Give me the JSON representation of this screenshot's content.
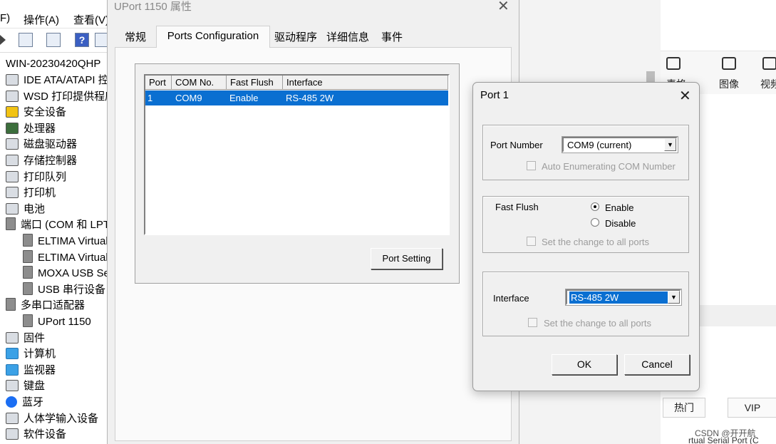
{
  "device_manager": {
    "menu": [
      "F)",
      "操作(A)",
      "查看(V)"
    ],
    "computer_name": "WIN-20230420QHP",
    "tree": [
      {
        "label": "IDE ATA/ATAPI 控",
        "icon": "ide-controller-icon"
      },
      {
        "label": "WSD 打印提供程序",
        "icon": "printer-provider-icon"
      },
      {
        "label": "安全设备",
        "icon": "security-device-icon"
      },
      {
        "label": "处理器",
        "icon": "processor-icon"
      },
      {
        "label": "磁盘驱动器",
        "icon": "disk-drive-icon"
      },
      {
        "label": "存储控制器",
        "icon": "storage-controller-icon"
      },
      {
        "label": "打印队列",
        "icon": "print-queue-icon"
      },
      {
        "label": "打印机",
        "icon": "printer-icon"
      },
      {
        "label": "电池",
        "icon": "battery-icon"
      },
      {
        "label": "端口 (COM 和 LPT",
        "icon": "port-icon"
      },
      {
        "label": "ELTIMA Virtual",
        "icon": "serial-port-icon"
      },
      {
        "label": "ELTIMA Virtual",
        "icon": "serial-port-icon"
      },
      {
        "label": "MOXA USB Se",
        "icon": "serial-port-icon"
      },
      {
        "label": "USB 串行设备",
        "icon": "serial-port-icon"
      },
      {
        "label": "多串口适配器",
        "icon": "multiport-adapter-icon"
      },
      {
        "label": "UPort 1150",
        "icon": "serial-port-icon"
      },
      {
        "label": "固件",
        "icon": "firmware-icon"
      },
      {
        "label": "计算机",
        "icon": "computer-icon"
      },
      {
        "label": "监视器",
        "icon": "monitor-icon"
      },
      {
        "label": "键盘",
        "icon": "keyboard-icon"
      },
      {
        "label": "蓝牙",
        "icon": "bluetooth-icon"
      },
      {
        "label": "人体学输入设备",
        "icon": "hid-icon"
      },
      {
        "label": "软件设备",
        "icon": "software-device-icon"
      }
    ]
  },
  "right_app": {
    "tabs": [
      {
        "label": "表格",
        "icon": "table-icon"
      },
      {
        "label": "图像",
        "icon": "image-icon"
      },
      {
        "label": "视频",
        "icon": "video-icon"
      }
    ],
    "buttons": [
      "热门",
      "VIP"
    ],
    "footer": [
      "rtual Serial Port (C",
      "CSDN @开开航"
    ]
  },
  "properties": {
    "title": "UPort 1150 属性",
    "tabs": [
      "常规",
      "Ports Configuration",
      "驱动程序",
      "详细信息",
      "事件"
    ],
    "active_tab": "Ports Configuration",
    "columns": [
      "Port",
      "COM No.",
      "Fast Flush",
      "Interface"
    ],
    "rows": [
      {
        "port": "1",
        "com": "COM9",
        "flush": "Enable",
        "iface": "RS-485 2W"
      }
    ],
    "port_setting_label": "Port Setting"
  },
  "port_dialog": {
    "title": "Port 1",
    "port_number_label": "Port Number",
    "port_number_value": "COM9 (current)",
    "auto_enum_label": "Auto Enumerating COM Number",
    "fast_flush_label": "Fast Flush",
    "enable_label": "Enable",
    "disable_label": "Disable",
    "fast_flush_selected": "Enable",
    "set_all_label_1": "Set the change to all ports",
    "interface_label": "Interface",
    "interface_value": "RS-485 2W",
    "set_all_label_2": "Set the change to all ports",
    "ok_label": "OK",
    "cancel_label": "Cancel"
  }
}
